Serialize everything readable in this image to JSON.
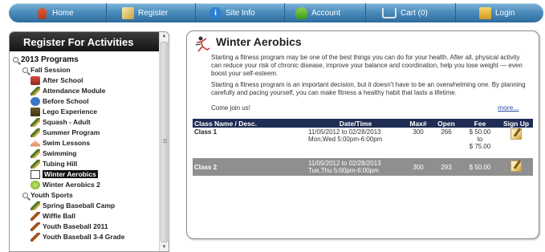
{
  "nav": {
    "items": [
      {
        "label": "Home",
        "icon": "home-icon"
      },
      {
        "label": "Register",
        "icon": "register-icon"
      },
      {
        "label": "Site Info",
        "icon": "info-icon"
      },
      {
        "label": "Account",
        "icon": "account-icon"
      },
      {
        "label": "Cart (0)",
        "icon": "cart-icon"
      },
      {
        "label": "Login",
        "icon": "login-icon"
      }
    ]
  },
  "sidebar": {
    "title": "Register For Activities",
    "tree": [
      {
        "label": "2013 Programs",
        "icon": "zoom-icon"
      },
      {
        "label": "Fall Session",
        "icon": "zoom-icon"
      },
      {
        "label": "After School",
        "icon": "school-icon"
      },
      {
        "label": "Attendance Module",
        "icon": "pencil-icon"
      },
      {
        "label": "Before School",
        "icon": "clock-icon"
      },
      {
        "label": "Lego Experience",
        "icon": "lego-icon"
      },
      {
        "label": "Squash - Adult",
        "icon": "pencil-icon"
      },
      {
        "label": "Summer Program",
        "icon": "pencil-icon"
      },
      {
        "label": "Swim Lessons",
        "icon": "swim-icon"
      },
      {
        "label": "Swimming",
        "icon": "pencil-icon"
      },
      {
        "label": "Tubing Hill",
        "icon": "pencil-icon"
      },
      {
        "label": "Winter Aerobics",
        "icon": "aerobics-icon",
        "selected": true
      },
      {
        "label": "Winter Aerobics 2",
        "icon": "green-ball-icon"
      },
      {
        "label": "Youth Sports",
        "icon": "zoom-icon"
      },
      {
        "label": "Spring Baseball Camp",
        "icon": "pencil-icon"
      },
      {
        "label": "Wiffle Ball",
        "icon": "bat-icon"
      },
      {
        "label": "Youth Baseball 2011",
        "icon": "bat-icon"
      },
      {
        "label": "Youth Baseball 3-4 Grade",
        "icon": "bat-icon"
      }
    ]
  },
  "activity": {
    "title": "Winter Aerobics",
    "paragraphs": [
      "Starting a fitness program may be one of the best things you can do for your health. After all, physical activity can reduce your risk of chronic disease, improve your balance and coordination, help you lose weight — even boost your self-esteem.",
      "Starting a fitness program is an important decision, but it doesn't have to be an overwhelming one. By planning carefully and pacing yourself, you can make fitness a healthy habit that lasts a lifetime.",
      "Come join us!"
    ],
    "more_label": "more...",
    "table": {
      "headers": [
        "Class Name / Desc.",
        "Date/Time",
        "Max#",
        "Open",
        "Fee",
        "Sign Up"
      ],
      "rows": [
        {
          "name": "Class 1",
          "date_line1": "11/05/2012 to 02/28/2013",
          "date_line2": "Mon,Wed 5:00pm-6:00pm",
          "max": "300",
          "open": "266",
          "fee_line1": "$ 50.00",
          "fee_line2": "to",
          "fee_line3": "$ 75.00"
        },
        {
          "name": "Class 2",
          "date_line1": "11/05/2012 to 02/28/2013",
          "date_line2": "Tue,Thu 5:00pm-6:00pm",
          "max": "300",
          "open": "293",
          "fee_line1": "$ 50.00"
        }
      ]
    }
  },
  "colors": {
    "nav_bar": "#4c8dbd",
    "sidebar_header": "#1a1a1a",
    "table_header": "#1f2d55",
    "row_alt": "#8f8f8f",
    "link": "#2a4ea0"
  }
}
